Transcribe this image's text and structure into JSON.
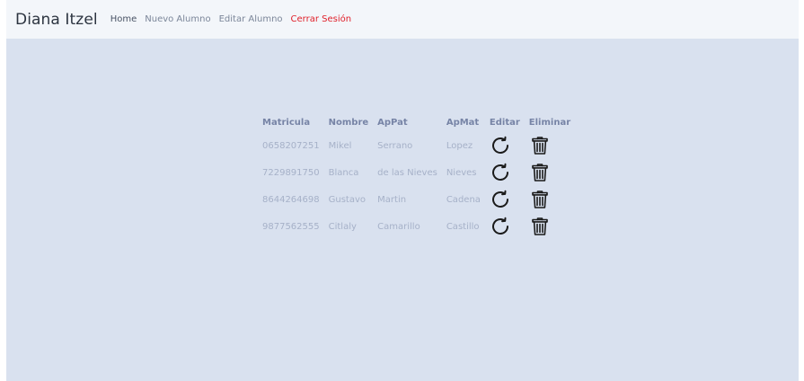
{
  "navbar": {
    "brand": "Diana Itzel",
    "links": [
      {
        "label": "Home"
      },
      {
        "label": "Nuevo Alumno"
      },
      {
        "label": "Editar Alumno"
      },
      {
        "label": "Cerrar Sesión"
      }
    ]
  },
  "table": {
    "headers": [
      "Matricula",
      "Nombre",
      "ApPat",
      "ApMat",
      "Editar",
      "Eliminar"
    ],
    "rows": [
      {
        "matricula": "0658207251",
        "nombre": "Mikel",
        "appat": "Serrano",
        "apmat": "Lopez"
      },
      {
        "matricula": "7229891750",
        "nombre": "Blanca",
        "appat": "de las Nieves",
        "apmat": "Nieves"
      },
      {
        "matricula": "8644264698",
        "nombre": "Gustavo",
        "appat": "Martin",
        "apmat": "Cadena"
      },
      {
        "matricula": "9877562555",
        "nombre": "Citlaly",
        "appat": "Camarillo",
        "apmat": "Castillo"
      }
    ],
    "row_icons": {
      "edit": "refresh-icon",
      "delete": "trash-icon"
    }
  },
  "colors": {
    "page_bg": "#d9e1ef",
    "navbar_bg": "#f3f6fa",
    "logout_link": "#e0202a",
    "header_text": "#7784a6",
    "cell_text": "#a6b1c8"
  }
}
